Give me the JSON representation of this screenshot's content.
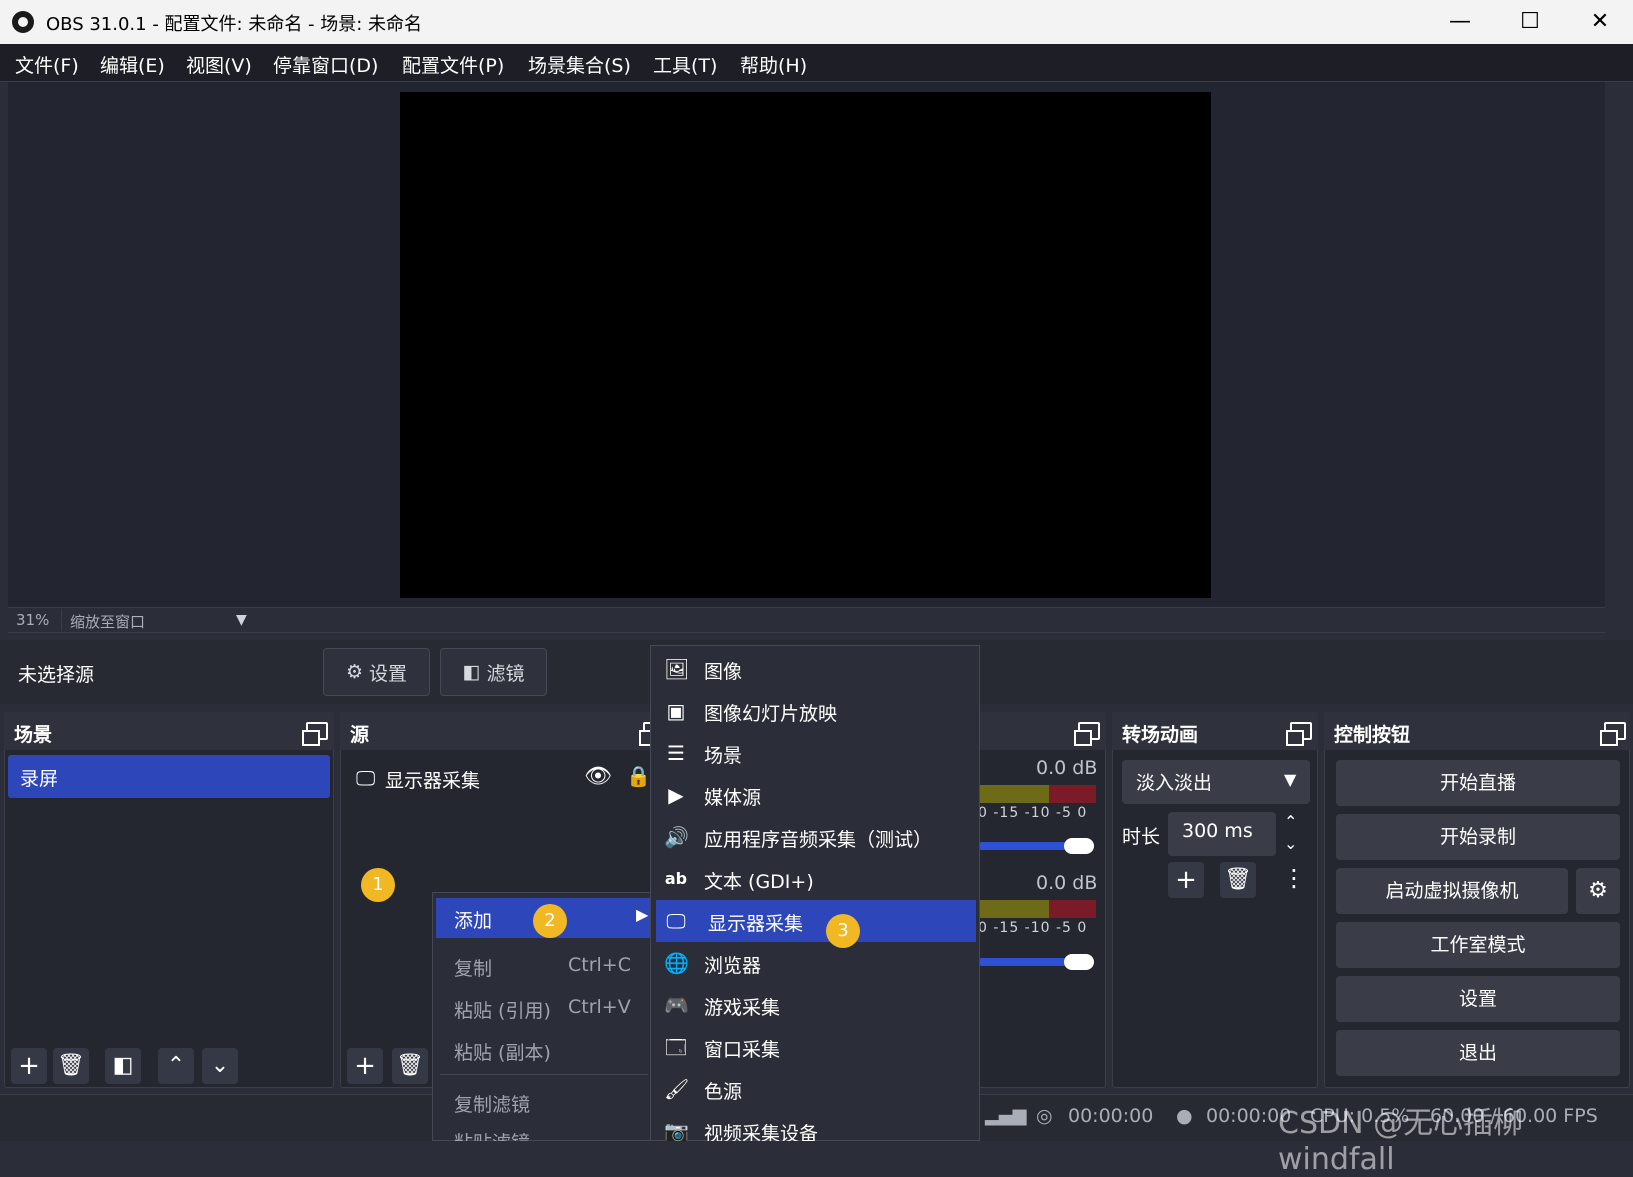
{
  "window": {
    "title": "OBS 31.0.1 - 配置文件: 未命名 - 场景: 未命名",
    "min": "—",
    "max": "☐",
    "close": "✕"
  },
  "menu": [
    "文件(F)",
    "编辑(E)",
    "视图(V)",
    "停靠窗口(D)",
    "配置文件(P)",
    "场景集合(S)",
    "工具(T)",
    "帮助(H)"
  ],
  "preview": {
    "zoom_percent": "31%",
    "zoom_mode": "缩放至窗口"
  },
  "source_toolbar": {
    "no_source": "未选择源",
    "settings": "设置",
    "filters": "滤镜"
  },
  "scenes": {
    "title": "场景",
    "items": [
      "录屏"
    ]
  },
  "sources": {
    "title": "源",
    "items": [
      {
        "name": "显示器采集"
      }
    ]
  },
  "mixer": {
    "channels": [
      {
        "db": "0.0 dB",
        "ticks": "0 -15 -10 -5 0"
      },
      {
        "db": "0.0 dB",
        "ticks": "0 -15 -10 -5 0"
      }
    ]
  },
  "transitions": {
    "title": "转场动画",
    "selected": "淡入淡出",
    "duration_label": "时长",
    "duration": "300 ms"
  },
  "controls": {
    "title": "控制按钮",
    "buttons": [
      "开始直播",
      "开始录制",
      "启动虚拟摄像机",
      "工作室模式",
      "设置",
      "退出"
    ]
  },
  "status": {
    "stream_time": "00:00:00",
    "rec_time": "00:00:00",
    "cpu": "CPU: 0.5%",
    "fps": "60.00 / 60.00 FPS"
  },
  "context_menu": {
    "add": "添加",
    "copy": "复制",
    "copy_shortcut": "Ctrl+C",
    "paste_ref": "粘贴 (引用)",
    "paste_ref_shortcut": "Ctrl+V",
    "paste_dup": "粘贴 (副本)",
    "copy_filters": "复制滤镜",
    "paste_filters": "粘贴滤镜"
  },
  "add_submenu": [
    {
      "label": "图像",
      "icon": "image-icon"
    },
    {
      "label": "图像幻灯片放映",
      "icon": "slideshow-icon"
    },
    {
      "label": "场景",
      "icon": "list-icon"
    },
    {
      "label": "媒体源",
      "icon": "play-icon"
    },
    {
      "label": "应用程序音频采集（测试）",
      "icon": "speaker-icon"
    },
    {
      "label": "文本 (GDI+)",
      "icon": "text-icon"
    },
    {
      "label": "显示器采集",
      "icon": "monitor-icon"
    },
    {
      "label": "浏览器",
      "icon": "globe-icon"
    },
    {
      "label": "游戏采集",
      "icon": "gamepad-icon"
    },
    {
      "label": "窗口采集",
      "icon": "window-icon"
    },
    {
      "label": "色源",
      "icon": "brush-icon"
    },
    {
      "label": "视频采集设备",
      "icon": "camera-icon"
    }
  ],
  "badges": [
    "1",
    "2",
    "3"
  ],
  "watermark": "CSDN @无心插柳windfall",
  "colors": {
    "accent": "#2d46b9",
    "badge": "#f2b824",
    "background": "#2b2e38"
  }
}
